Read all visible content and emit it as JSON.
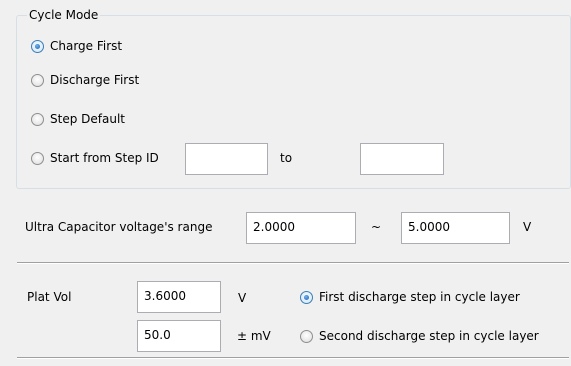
{
  "cycle_mode": {
    "title": "Cycle Mode",
    "options": [
      {
        "label": "Charge First",
        "checked": true
      },
      {
        "label": "Discharge First",
        "checked": false
      },
      {
        "label": "Step Default",
        "checked": false
      },
      {
        "label": "Start from Step ID",
        "checked": false
      }
    ],
    "step_id_from_value": "",
    "to_label": "to",
    "step_id_to_value": ""
  },
  "voltage_range": {
    "label": "Ultra Capacitor voltage's range",
    "min_value": "2.0000",
    "tilde": "~",
    "max_value": "5.0000",
    "unit": "V"
  },
  "plat": {
    "label": "Plat Vol",
    "vol_value": "3.6000",
    "vol_unit": "V",
    "mv_value": "50.0",
    "mv_unit": "± mV",
    "options": [
      {
        "label": "First discharge step in cycle layer",
        "checked": true
      },
      {
        "label": "Second discharge step in cycle layer",
        "checked": false
      }
    ]
  }
}
